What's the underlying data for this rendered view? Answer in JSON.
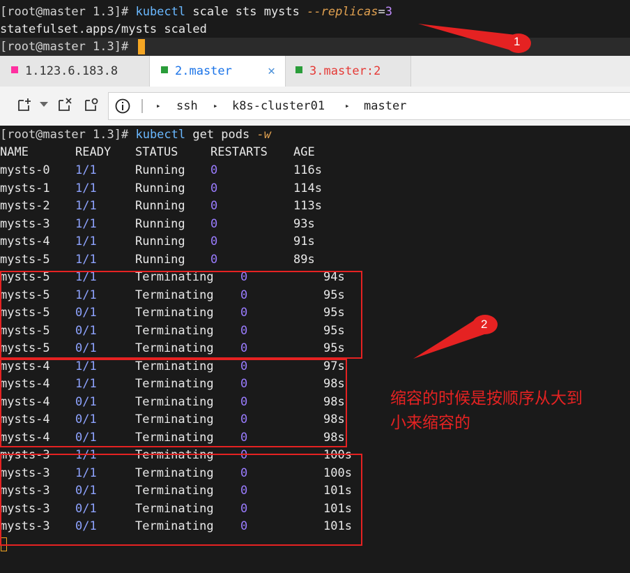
{
  "top_terminal": {
    "line1": {
      "prompt": "[root@master 1.3]# ",
      "cmd": "kubectl",
      "rest": " scale sts mysts ",
      "flag": "--replicas",
      "eq": "=",
      "num": "3"
    },
    "line2": "statefulset.apps/mysts scaled",
    "line3": {
      "prompt": "[root@master 1.3]# "
    }
  },
  "tabs": [
    {
      "label": "1.123.6.183.8",
      "color": "#ff2fa0",
      "text_color": "#333333"
    },
    {
      "label": "2.master",
      "color": "#2a9d3a",
      "text_color": "#1a73e8",
      "close": "✕"
    },
    {
      "label": "3.master:2",
      "color": "#2a9d3a",
      "text_color": "#e53935"
    }
  ],
  "toolbar": {
    "info_icon": "i",
    "breadcrumbs": [
      "ssh",
      "k8s-cluster01",
      "master"
    ]
  },
  "main_terminal": {
    "command": {
      "prompt": "[root@master 1.3]# ",
      "cmd": "kubectl",
      "rest": " get pods ",
      "flag": "-w"
    },
    "headers": [
      "NAME",
      "READY",
      "STATUS",
      "RESTARTS",
      "AGE"
    ],
    "rows": [
      {
        "name": "mysts-0",
        "ready": "1/1",
        "status": "Running",
        "restarts": "0",
        "age": "116s"
      },
      {
        "name": "mysts-1",
        "ready": "1/1",
        "status": "Running",
        "restarts": "0",
        "age": "114s"
      },
      {
        "name": "mysts-2",
        "ready": "1/1",
        "status": "Running",
        "restarts": "0",
        "age": "113s"
      },
      {
        "name": "mysts-3",
        "ready": "1/1",
        "status": "Running",
        "restarts": "0",
        "age": "93s"
      },
      {
        "name": "mysts-4",
        "ready": "1/1",
        "status": "Running",
        "restarts": "0",
        "age": "91s"
      },
      {
        "name": "mysts-5",
        "ready": "1/1",
        "status": "Running",
        "restarts": "0",
        "age": "89s"
      },
      {
        "name": "mysts-5",
        "ready": "1/1",
        "status": "Terminating",
        "restarts": "0",
        "age": "94s"
      },
      {
        "name": "mysts-5",
        "ready": "1/1",
        "status": "Terminating",
        "restarts": "0",
        "age": "95s"
      },
      {
        "name": "mysts-5",
        "ready": "0/1",
        "status": "Terminating",
        "restarts": "0",
        "age": "95s"
      },
      {
        "name": "mysts-5",
        "ready": "0/1",
        "status": "Terminating",
        "restarts": "0",
        "age": "95s"
      },
      {
        "name": "mysts-5",
        "ready": "0/1",
        "status": "Terminating",
        "restarts": "0",
        "age": "95s"
      },
      {
        "name": "mysts-4",
        "ready": "1/1",
        "status": "Terminating",
        "restarts": "0",
        "age": "97s"
      },
      {
        "name": "mysts-4",
        "ready": "1/1",
        "status": "Terminating",
        "restarts": "0",
        "age": "98s"
      },
      {
        "name": "mysts-4",
        "ready": "0/1",
        "status": "Terminating",
        "restarts": "0",
        "age": "98s"
      },
      {
        "name": "mysts-4",
        "ready": "0/1",
        "status": "Terminating",
        "restarts": "0",
        "age": "98s"
      },
      {
        "name": "mysts-4",
        "ready": "0/1",
        "status": "Terminating",
        "restarts": "0",
        "age": "98s"
      },
      {
        "name": "mysts-3",
        "ready": "1/1",
        "status": "Terminating",
        "restarts": "0",
        "age": "100s"
      },
      {
        "name": "mysts-3",
        "ready": "1/1",
        "status": "Terminating",
        "restarts": "0",
        "age": "100s"
      },
      {
        "name": "mysts-3",
        "ready": "0/1",
        "status": "Terminating",
        "restarts": "0",
        "age": "101s"
      },
      {
        "name": "mysts-3",
        "ready": "0/1",
        "status": "Terminating",
        "restarts": "0",
        "age": "101s"
      },
      {
        "name": "mysts-3",
        "ready": "0/1",
        "status": "Terminating",
        "restarts": "0",
        "age": "101s"
      }
    ]
  },
  "annotations": {
    "marker1": "1",
    "marker2": "2",
    "note_line1": "缩容的时候是按顺序从大到",
    "note_line2": "小来缩容的",
    "color": "#e52222"
  }
}
